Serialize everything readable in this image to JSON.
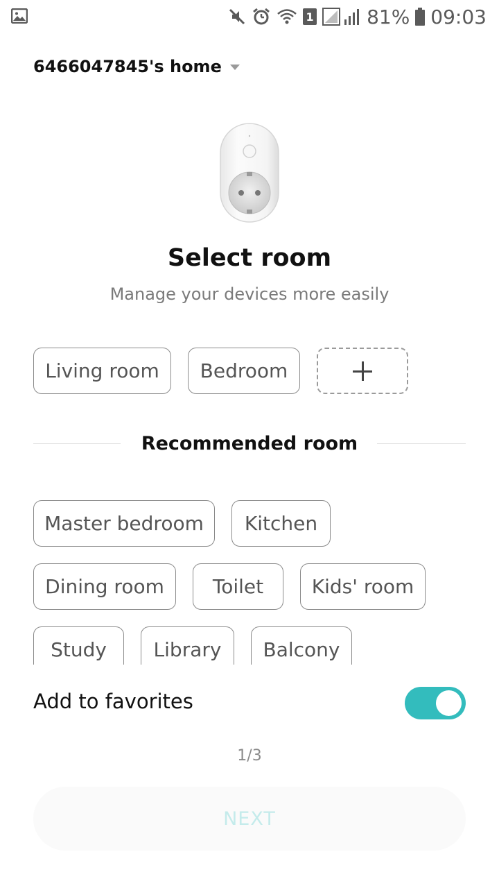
{
  "status_bar": {
    "battery": "81%",
    "time": "09:03",
    "sim": "1",
    "icons": [
      "gallery-icon",
      "mute-icon",
      "alarm-icon",
      "wifi-icon",
      "signal-icon",
      "battery-icon"
    ]
  },
  "home": {
    "name": "6466047845's home"
  },
  "device_image": {
    "icon": "smart-plug-image"
  },
  "header": {
    "title": "Select room",
    "subtitle": "Manage your devices more easily"
  },
  "rooms": [
    "Living room",
    "Bedroom"
  ],
  "add_room": {
    "icon": "plus-icon"
  },
  "recommended": {
    "title": "Recommended room",
    "rooms": [
      "Master bedroom",
      "Kitchen",
      "Dining room",
      "Toilet",
      "Kids' room",
      "Study",
      "Library",
      "Balcony"
    ]
  },
  "favorites": {
    "label": "Add to favorites",
    "enabled": true
  },
  "pagination": {
    "text": "1/3"
  },
  "next_button": {
    "label": "NEXT"
  },
  "colors": {
    "accent": "#33bcbd",
    "next_text": "#c4ebeb"
  }
}
